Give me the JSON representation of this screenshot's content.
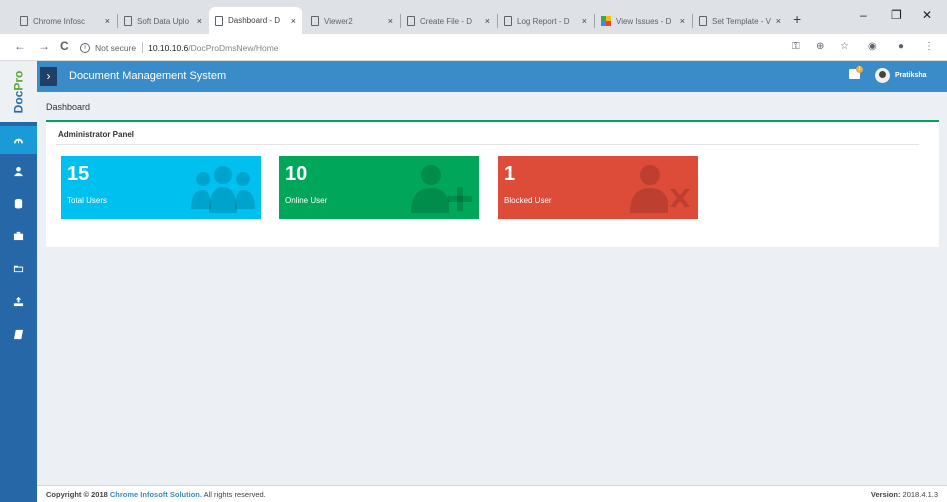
{
  "browser": {
    "tabs": [
      {
        "label": "Chrome Infosc",
        "active": false
      },
      {
        "label": "Soft Data Uplo",
        "active": false
      },
      {
        "label": "Dashboard - D",
        "active": true
      },
      {
        "label": "Viewer2",
        "active": false
      },
      {
        "label": "Create File - D",
        "active": false
      },
      {
        "label": "Log Report - D",
        "active": false
      },
      {
        "label": "View Issues - D",
        "active": false
      },
      {
        "label": "Set Template - V",
        "active": false
      }
    ],
    "close_glyph": "×",
    "new_tab_glyph": "+",
    "window": {
      "minimize": "–",
      "maximize": "❐",
      "close": "✕"
    },
    "address": {
      "security_label": "Not secure",
      "host": "10.10.10.6",
      "path": "/DocProDmsNew/Home"
    },
    "nav": {
      "back": "←",
      "forward": "→",
      "reload": "C"
    },
    "toolbar_icons": {
      "key": "⚿",
      "zoom": "⊕",
      "star": "☆",
      "extension": "◉",
      "profile": "●",
      "menu": "⋮"
    }
  },
  "app": {
    "logo_part1": "Doc",
    "logo_part2": "Pro",
    "title": "Document Management System",
    "toggle_glyph": "›",
    "notification_count": "1",
    "user_name": "Pratiksha",
    "breadcrumb": "Dashboard",
    "panel_title": "Administrator Panel",
    "sidebar_icons": [
      "dashboard-icon",
      "user-icon",
      "database-icon",
      "briefcase-icon",
      "folder-icon",
      "upload-icon",
      "book-icon"
    ],
    "stats": [
      {
        "value": "15",
        "label": "Total Users",
        "color": "#00c0ef",
        "icon": "users-icon"
      },
      {
        "value": "10",
        "label": "Online User",
        "color": "#00a65a",
        "icon": "user-plus-icon"
      },
      {
        "value": "1",
        "label": "Blocked User",
        "color": "#dd4b39",
        "icon": "user-times-icon"
      }
    ],
    "footer": {
      "copyright_prefix": "Copyright © 2018",
      "company": "Chrome Infosoft Solution.",
      "rights": "All rights reserved.",
      "version_label": "Version:",
      "version": "2018.4.1.3"
    }
  }
}
